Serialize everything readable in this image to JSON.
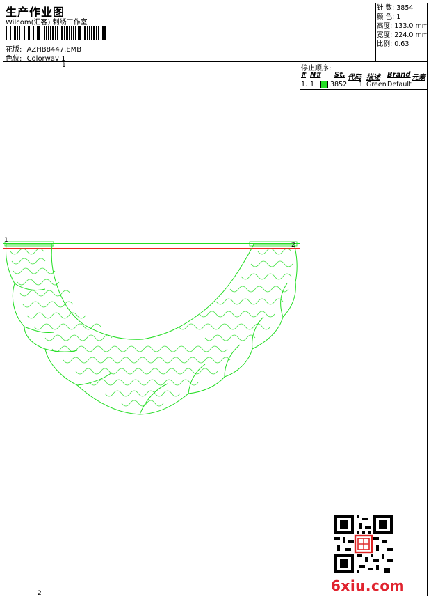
{
  "header": {
    "title": "生产作业图",
    "studio": "Wilcom(汇客) 刺绣工作室",
    "design_label": "花版:",
    "design_value": "AZHB8447.EMB",
    "colorway_label": "色位:",
    "colorway_value": "Colorway 1"
  },
  "stats": {
    "stitches_label": "针 数:",
    "stitches_value": "3854",
    "colors_label": "颜 色:",
    "colors_value": "1",
    "height_label": "高度:",
    "height_value": "133.0 mm",
    "width_label": "宽度:",
    "width_value": "224.0 mm",
    "scale_label": "比例:",
    "scale_value": "0.63"
  },
  "stop_sequence": {
    "title": "停止顺序:",
    "columns": [
      "#",
      "N#",
      "St.",
      "代码",
      "描述",
      "Brand",
      "元素"
    ],
    "rows": [
      {
        "index": "1.",
        "needle": "1",
        "swatch_color": "#22dd22",
        "stitch": "3852",
        "code": "1",
        "desc": "Green",
        "brand": "Default",
        "element": ""
      }
    ]
  },
  "guides": {
    "label_1_top": "1",
    "label_1_left": "1",
    "label_2_right": "2",
    "label_2_bottom": "2"
  },
  "colors": {
    "design": "#22dd22",
    "guide_red": "#ee2222",
    "guide_green": "#22dd22",
    "watermark": "#e0232e"
  },
  "watermark": "6xiu.com"
}
